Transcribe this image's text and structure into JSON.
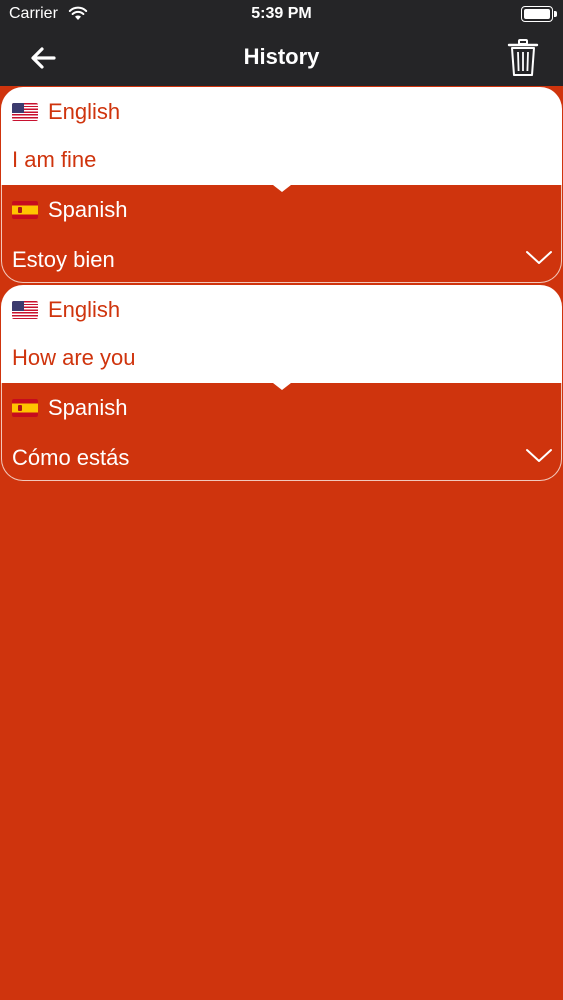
{
  "status_bar": {
    "carrier": "Carrier",
    "time": "5:39 PM"
  },
  "nav": {
    "title": "History",
    "back_icon": "arrow-left-icon",
    "trash_icon": "trash-icon"
  },
  "colors": {
    "accent": "#cf340d",
    "nav_bg": "#252527",
    "card_top": "#ffffff"
  },
  "history": [
    {
      "source_lang": "English",
      "source_flag": "us-flag-icon",
      "source_text": "I am fine",
      "target_lang": "Spanish",
      "target_flag": "es-flag-icon",
      "target_text": "Estoy bien"
    },
    {
      "source_lang": "English",
      "source_flag": "us-flag-icon",
      "source_text": "How are you",
      "target_lang": "Spanish",
      "target_flag": "es-flag-icon",
      "target_text": "Cómo estás"
    }
  ]
}
